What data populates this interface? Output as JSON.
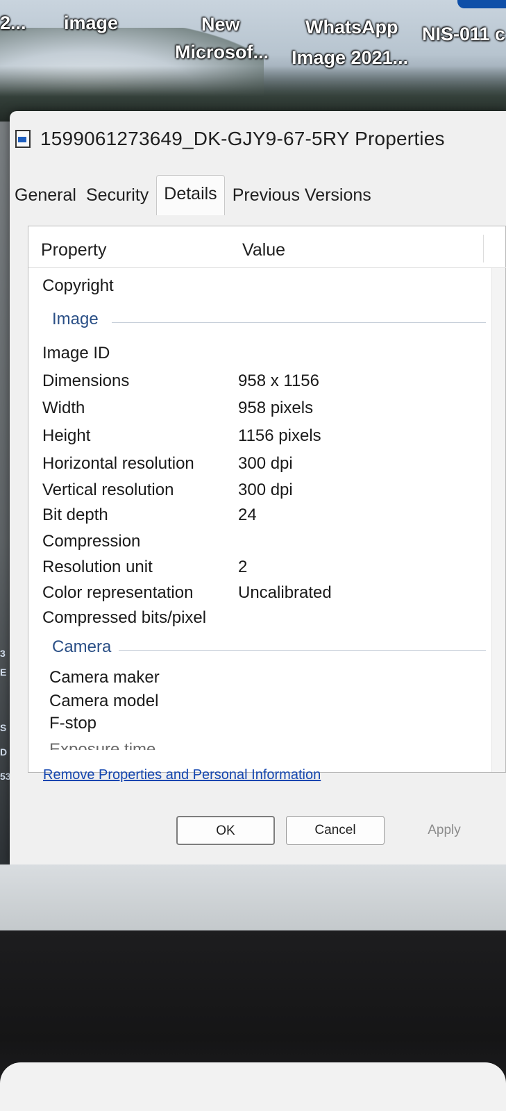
{
  "desktop": {
    "icons": [
      {
        "label": "2..."
      },
      {
        "label": "image"
      },
      {
        "label": "New"
      },
      {
        "label": "Microsof..."
      },
      {
        "label": "WhatsApp"
      },
      {
        "label": "Image 2021..."
      },
      {
        "label": "NIS-011 c"
      }
    ]
  },
  "window": {
    "title": "1599061273649_DK-GJY9-67-5RY Properties"
  },
  "tabs": [
    {
      "label": "General"
    },
    {
      "label": "Security"
    },
    {
      "label": "Details",
      "active": true
    },
    {
      "label": "Previous Versions"
    }
  ],
  "details": {
    "col_property": "Property",
    "col_value": "Value",
    "copyright": "Copyright",
    "group_image": "Image",
    "rows_image": [
      {
        "k": "Image ID",
        "v": ""
      },
      {
        "k": "Dimensions",
        "v": "958 x 1156"
      },
      {
        "k": "Width",
        "v": "958 pixels"
      },
      {
        "k": "Height",
        "v": "1156 pixels"
      },
      {
        "k": "Horizontal resolution",
        "v": "300 dpi"
      },
      {
        "k": "Vertical resolution",
        "v": "300 dpi"
      },
      {
        "k": "Bit depth",
        "v": "24"
      },
      {
        "k": "Compression",
        "v": ""
      },
      {
        "k": "Resolution unit",
        "v": "2"
      },
      {
        "k": "Color representation",
        "v": "Uncalibrated"
      },
      {
        "k": "Compressed bits/pixel",
        "v": ""
      }
    ],
    "group_camera": "Camera",
    "rows_camera": [
      {
        "k": "Camera maker",
        "v": ""
      },
      {
        "k": "Camera model",
        "v": ""
      },
      {
        "k": "F-stop",
        "v": ""
      },
      {
        "k": "Exposure time",
        "v": ""
      }
    ]
  },
  "link": "Remove Properties and Personal Information",
  "buttons": {
    "ok": "OK",
    "cancel": "Cancel",
    "apply": "Apply"
  },
  "edge_marks": [
    "3",
    "E",
    "S",
    "D",
    "53"
  ]
}
